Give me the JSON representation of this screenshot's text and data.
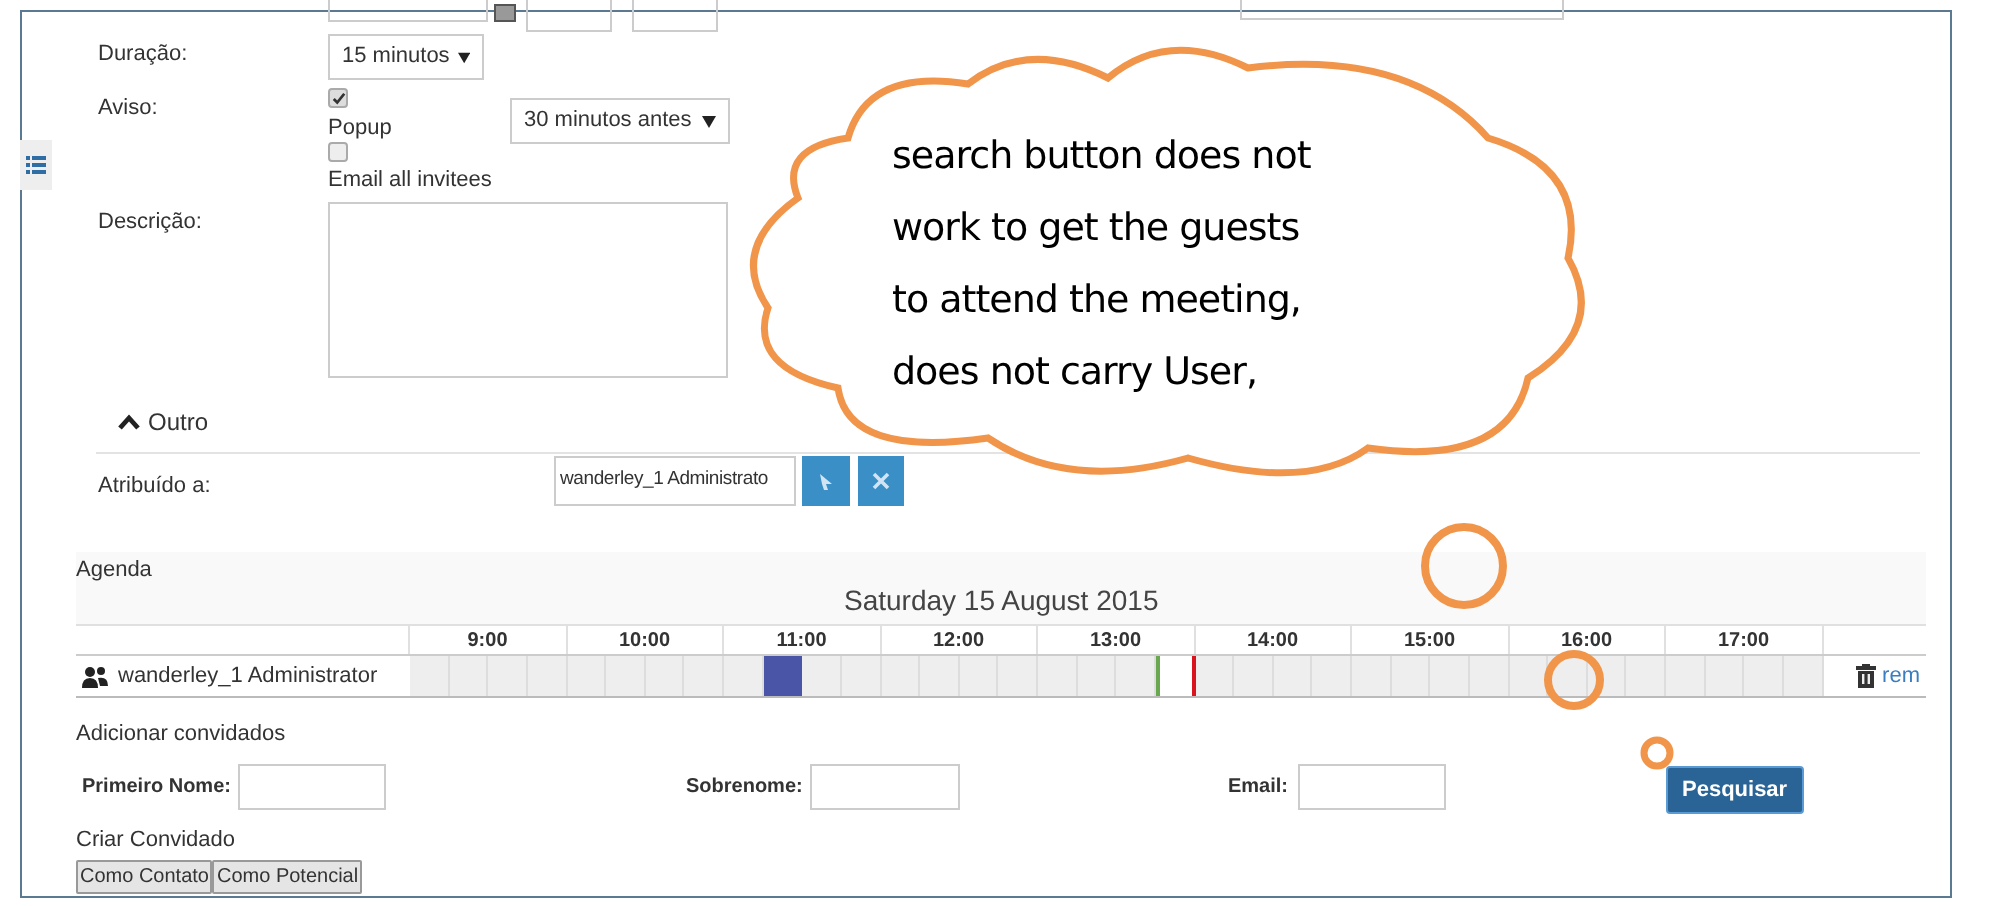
{
  "form": {
    "duration": {
      "label": "Duração:",
      "value": "15 minutos"
    },
    "alert": {
      "label": "Aviso:",
      "popup_checked": true,
      "popup_label": "Popup",
      "popup_time": "30 minutos antes",
      "email_checked": false,
      "email_label": "Email all invitees"
    },
    "description": {
      "label": "Descrição:"
    },
    "other_section": {
      "label": "Outro",
      "expanded": true
    },
    "assigned": {
      "label": "Atribuído a:",
      "value": "wanderley_1 Administrato"
    }
  },
  "agenda": {
    "label": "Agenda",
    "date": "Saturday 15 August 2015",
    "hours": [
      "9:00",
      "10:00",
      "11:00",
      "12:00",
      "13:00",
      "14:00",
      "15:00",
      "16:00",
      "17:00"
    ],
    "rows": [
      {
        "name": "wanderley_1 Administrator",
        "remove_label": "rem",
        "slots": [
          {
            "kind": "free"
          },
          {
            "kind": "free"
          },
          {
            "kind": "free"
          },
          {
            "kind": "free"
          },
          {
            "kind": "free"
          },
          {
            "kind": "free"
          },
          {
            "kind": "free"
          },
          {
            "kind": "free"
          },
          {
            "kind": "free"
          },
          {
            "kind": "busy"
          },
          {
            "kind": "free"
          },
          {
            "kind": "free"
          },
          {
            "kind": "free"
          },
          {
            "kind": "free"
          },
          {
            "kind": "free"
          },
          {
            "kind": "free"
          },
          {
            "kind": "free"
          },
          {
            "kind": "free"
          },
          {
            "kind": "free"
          },
          {
            "kind": "meeting"
          },
          {
            "kind": "free"
          },
          {
            "kind": "free"
          },
          {
            "kind": "free"
          },
          {
            "kind": "free"
          },
          {
            "kind": "free"
          },
          {
            "kind": "free"
          },
          {
            "kind": "free"
          },
          {
            "kind": "free"
          },
          {
            "kind": "free"
          },
          {
            "kind": "free"
          },
          {
            "kind": "free"
          },
          {
            "kind": "free"
          },
          {
            "kind": "free"
          },
          {
            "kind": "free"
          },
          {
            "kind": "free"
          },
          {
            "kind": "free"
          }
        ]
      }
    ]
  },
  "guests": {
    "title": "Adicionar convidados",
    "first_name_label": "Primeiro Nome:",
    "last_name_label": "Sobrenome:",
    "email_label": "Email:",
    "search_button": "Pesquisar",
    "create_title": "Criar Convidado",
    "create_buttons": [
      "Como Contato",
      "Como Potencial"
    ]
  },
  "annotation": {
    "lines": [
      "search button does not",
      "work to get the guests",
      "to attend the meeting,",
      "does not carry User,"
    ]
  }
}
